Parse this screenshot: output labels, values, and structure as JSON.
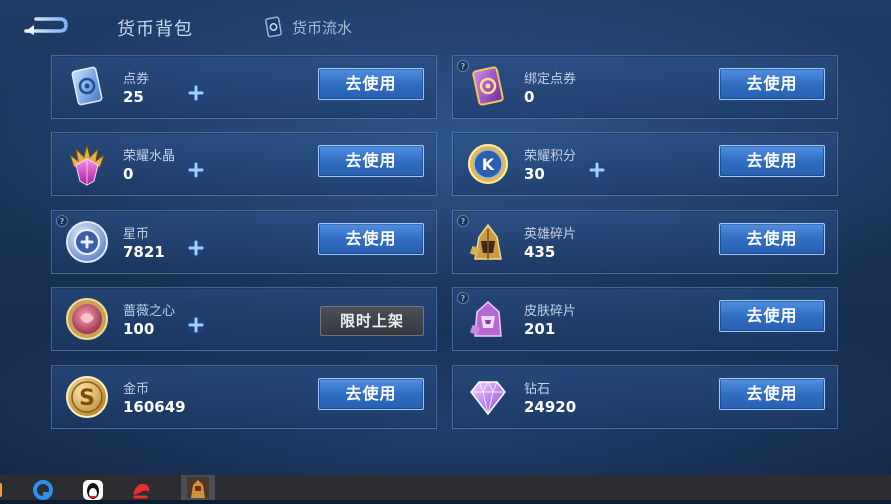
{
  "header": {
    "title": "货币背包",
    "flow_label": "货币流水"
  },
  "cards": [
    {
      "name": "点券",
      "value": "25",
      "action": "去使用",
      "icon": "coupon-card-icon",
      "has_plus": true,
      "has_help": false
    },
    {
      "name": "绑定点券",
      "value": "0",
      "action": "去使用",
      "icon": "bound-coupon-card-icon",
      "has_plus": false,
      "has_help": true
    },
    {
      "name": "荣耀水晶",
      "value": "0",
      "action": "去使用",
      "icon": "glory-crystal-icon",
      "has_plus": true,
      "has_help": false
    },
    {
      "name": "荣耀积分",
      "value": "30",
      "action": "去使用",
      "icon": "glory-points-icon",
      "has_plus": true,
      "has_help": false
    },
    {
      "name": "星币",
      "value": "7821",
      "action": "去使用",
      "icon": "star-coin-icon",
      "has_plus": true,
      "has_help": true
    },
    {
      "name": "英雄碎片",
      "value": "435",
      "action": "去使用",
      "icon": "hero-fragment-icon",
      "has_plus": false,
      "has_help": true
    },
    {
      "name": "蔷薇之心",
      "value": "100",
      "action": "限时上架",
      "icon": "rose-heart-icon",
      "has_plus": true,
      "has_help": false
    },
    {
      "name": "皮肤碎片",
      "value": "201",
      "action": "去使用",
      "icon": "skin-fragment-icon",
      "has_plus": false,
      "has_help": true
    },
    {
      "name": "金币",
      "value": "160649",
      "action": "去使用",
      "icon": "gold-coin-icon",
      "has_plus": false,
      "has_help": false
    },
    {
      "name": "钻石",
      "value": "24920",
      "action": "去使用",
      "icon": "diamond-icon",
      "has_plus": false,
      "has_help": false
    }
  ],
  "taskbar": {
    "apps": [
      "partial-app-icon",
      "browser-icon",
      "qq-penguin-icon",
      "red-bird-icon",
      "game-hero-icon"
    ]
  },
  "colors": {
    "accent_button": "#3a78cf",
    "disabled_button": "#3d4248",
    "background": "#1a3559",
    "taskbar": "#2b2d31"
  }
}
